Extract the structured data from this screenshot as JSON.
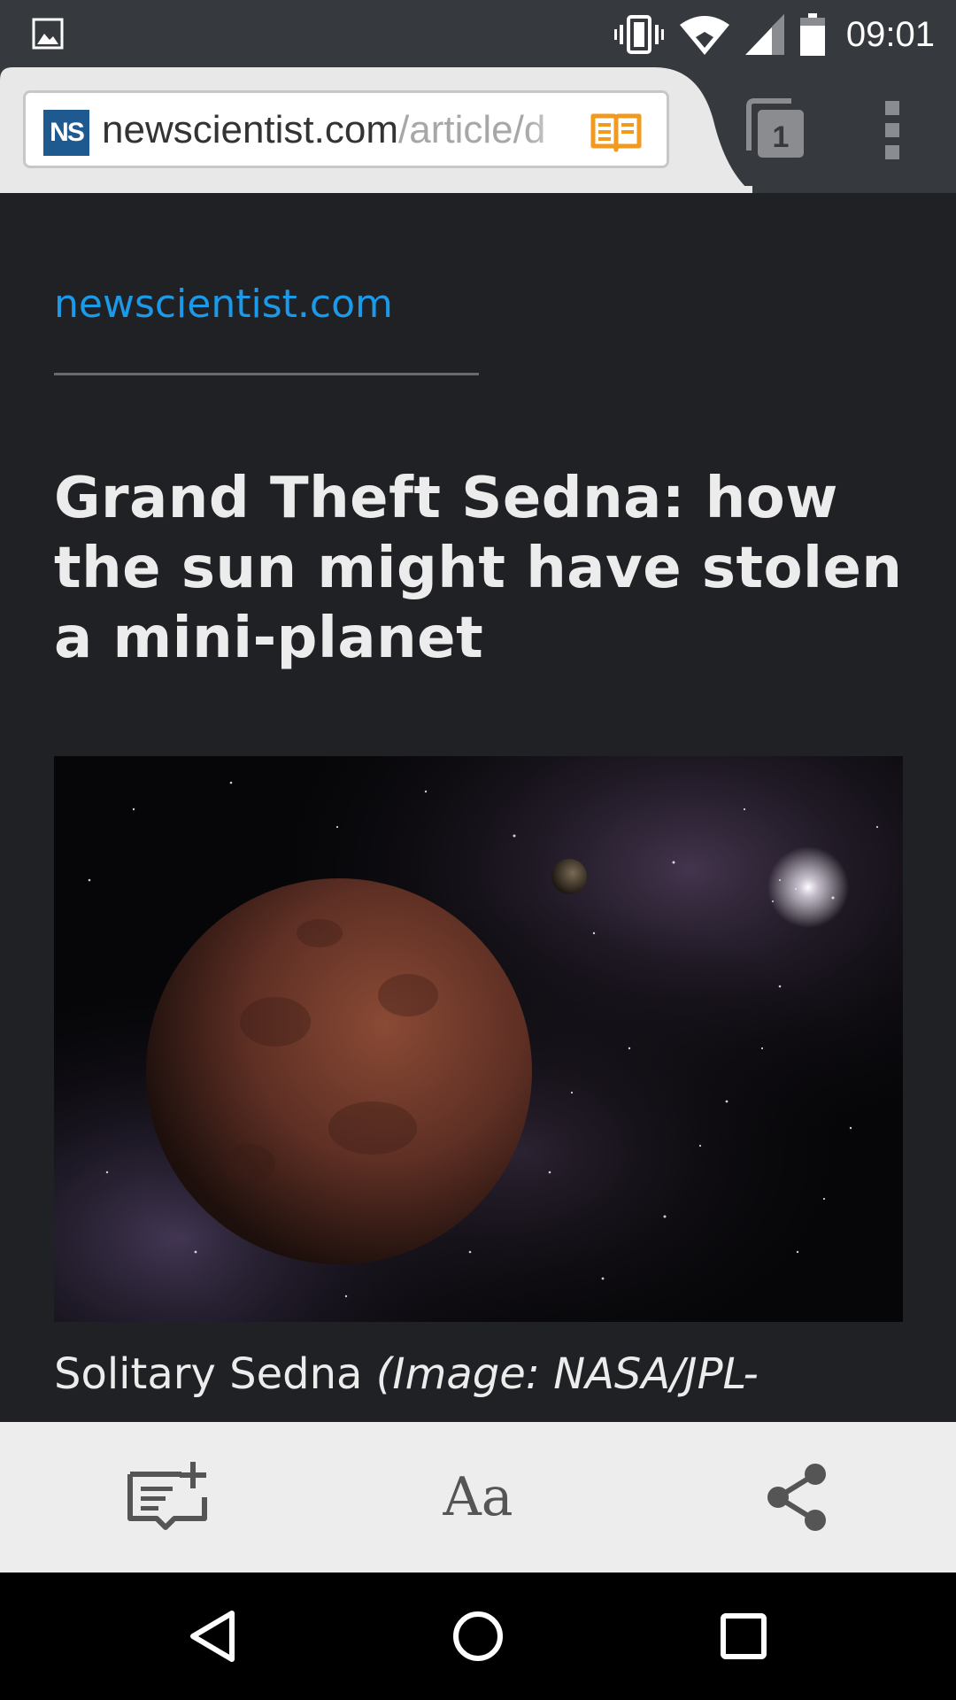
{
  "status_bar": {
    "time": "09:01",
    "icons": [
      "image-notification-icon",
      "vibrate-icon",
      "wifi-icon",
      "signal-icon",
      "battery-icon"
    ]
  },
  "browser": {
    "url_domain": "newscientist.com",
    "url_path": "/article/d",
    "site_logo_text": "NS",
    "tab_count": "1",
    "colors": {
      "toolbar": "#36393d",
      "reader_icon": "#f29a1e",
      "logo": "#1e5a8f"
    }
  },
  "article": {
    "site": "newscientist.com",
    "headline": "Grand Theft Sedna: how the sun might have stolen a mini-planet",
    "caption_text": "Solitary Sedna ",
    "caption_credit": "(Image: NASA/JPL-",
    "colors": {
      "link": "#1a9ae8",
      "background": "#202124",
      "text": "#ececec"
    }
  },
  "reader_bar": {
    "items": [
      "add-to-reading-list-icon",
      "text-size-icon",
      "share-icon"
    ],
    "text_size_label": "Aa"
  },
  "nav_bar": {
    "items": [
      "back-icon",
      "home-icon",
      "recents-icon"
    ]
  }
}
